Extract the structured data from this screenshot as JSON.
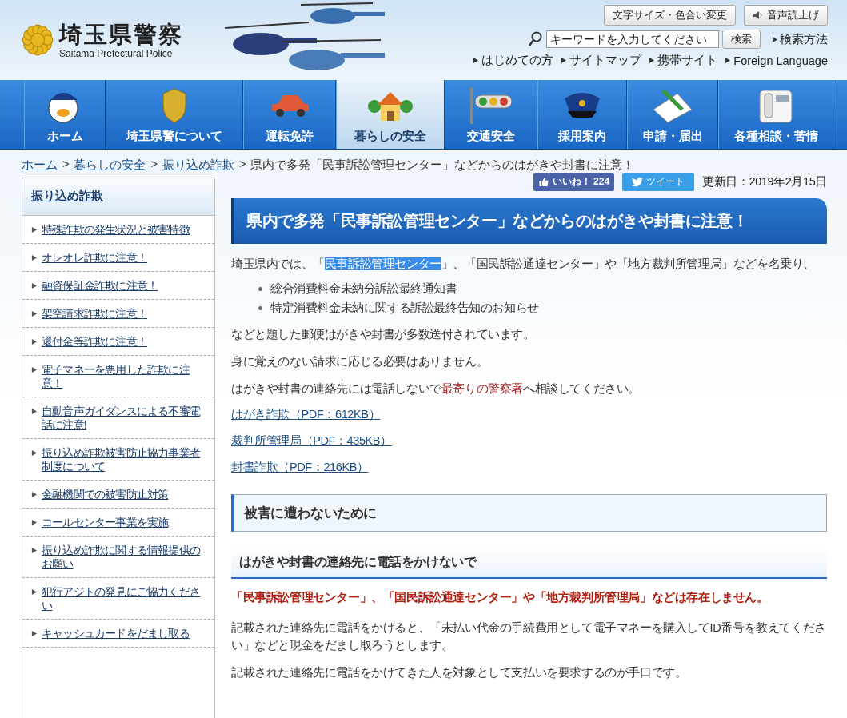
{
  "header": {
    "logo_title": "埼玉県警察",
    "logo_subtitle": "Saitama Prefectural Police",
    "tools": [
      "文字サイズ・色合い変更",
      "音声読上げ"
    ],
    "search": {
      "placeholder": "キーワードを入力してください",
      "button": "検索",
      "help": "検索方法"
    },
    "links": [
      "はじめての方",
      "サイトマップ",
      "携帯サイト",
      "Foreign Language"
    ]
  },
  "nav": [
    {
      "label": "ホーム",
      "selected": false,
      "kind": "mascot"
    },
    {
      "label": "埼玉県警について",
      "selected": false,
      "kind": "badge"
    },
    {
      "label": "運転免許",
      "selected": false,
      "kind": "car"
    },
    {
      "label": "暮らしの安全",
      "selected": true,
      "kind": "house"
    },
    {
      "label": "交通安全",
      "selected": false,
      "kind": "signal"
    },
    {
      "label": "採用案内",
      "selected": false,
      "kind": "cap"
    },
    {
      "label": "申請・届出",
      "selected": false,
      "kind": "form"
    },
    {
      "label": "各種相談・苦情",
      "selected": false,
      "kind": "phone"
    }
  ],
  "breadcrumb": {
    "separator": ">",
    "links": [
      "ホーム",
      "暮らしの安全",
      "振り込め詐欺"
    ],
    "current": "県内で多発「民事訴訟管理センター」などからのはがきや封書に注意！"
  },
  "sidebar": {
    "title": "振り込め詐欺",
    "items": [
      "特殊詐欺の発生状況と被害特徴",
      "オレオレ詐欺に注意！",
      "融資保証金詐欺に注意！",
      "架空請求詐欺に注意！",
      "還付金等詐欺に注意！",
      "電子マネーを悪用した詐欺に注意！",
      "自動音声ガイダンスによる不審電話に注意!",
      "振り込め詐欺被害防止協力事業者制度について",
      "金融機関での被害防止対策",
      "コールセンター事業を実施",
      "振り込め詐欺に関する情報提供のお願い",
      "犯行アジトの発見にご協力ください",
      "キャッシュカードをだまし取る"
    ]
  },
  "social": {
    "like": "いいね！",
    "like_count": "224",
    "tweet": "ツイート",
    "updated": "更新日：2019年2月15日"
  },
  "title": "県内で多発「民事訴訟管理センター」などからのはがきや封書に注意！",
  "intro": [
    {
      "text": "埼玉県内では、「",
      "kind": "plain"
    },
    {
      "text": "民事訴訟管理センター",
      "kind": "highlight"
    },
    {
      "text": "」、「国民訴訟通達センター」や「地方裁判所管理局」などを名乗り、",
      "kind": "plain"
    }
  ],
  "bullets": [
    "総合消費料金未納分訴訟最終通知書",
    "特定消費料金未納に関する訴訟最終告知のお知らせ"
  ],
  "paragraphs": [
    [
      {
        "text": "などと題した郵便はがきや封書が多数送付されています。",
        "kind": "plain"
      }
    ],
    [
      {
        "text": "身に覚えのない請求に応じる必要はありません。",
        "kind": "plain"
      }
    ],
    [
      {
        "text": "はがきや封書の連絡先には電話しないで",
        "kind": "plain"
      },
      {
        "text": "最寄りの警察署",
        "kind": "link"
      },
      {
        "text": "へ相談してください。",
        "kind": "plain"
      }
    ]
  ],
  "files": [
    "はがき詐欺（PDF：612KB）",
    "裁判所管理局（PDF：435KB）",
    "封書詐欺（PDF：216KB）"
  ],
  "section_heading": "被害に遭わないために",
  "sub_heading": "はがきや封書の連絡先に電話をかけないで",
  "warning": "「民事訴訟管理センター」、「国民訴訟通達センター」や「地方裁判所管理局」などは存在しません。",
  "body": [
    "記載された連絡先に電話をかけると、「未払い代金の手続費用として電子マネーを購入してID番号を教えてください」などと現金をだまし取ろうとします。",
    "記載された連絡先に電話をかけてきた人を対象として支払いを要求するのが手口です。"
  ]
}
